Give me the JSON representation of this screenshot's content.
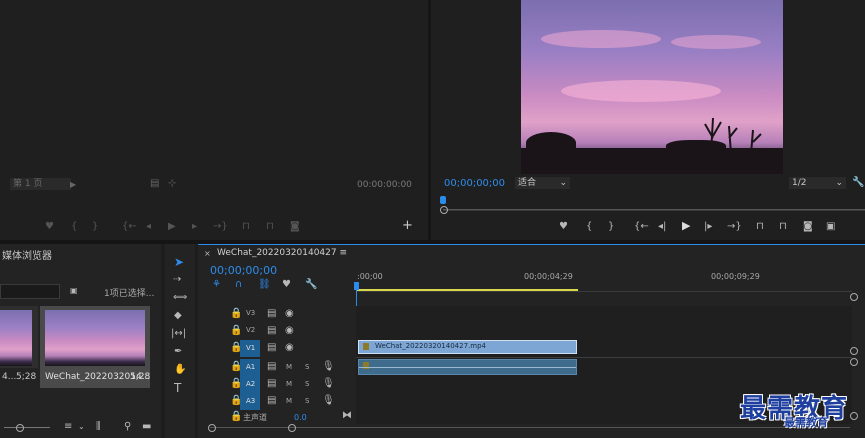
{
  "source_monitor": {
    "page_select": "第 1 页",
    "timecode": "00:00:00:00"
  },
  "program_monitor": {
    "timecode": "00;00;00;00",
    "fit_select": "适合",
    "resolution_select": "1/2"
  },
  "project_panel": {
    "title": "媒体浏览器",
    "selection_status": "1项已选择...",
    "items": [
      {
        "name": "4...",
        "duration": "5;28"
      },
      {
        "name": "WeChat_2022032014...",
        "duration": "5;28"
      }
    ]
  },
  "timeline": {
    "sequence_name": "WeChat_20220320140427",
    "menu_icon": "≡",
    "timecode": "00;00;00;00",
    "ruler_labels": [
      ":00;00",
      "00;00;04;29",
      "00;00;09;29"
    ],
    "video_tracks": [
      {
        "name": "V3"
      },
      {
        "name": "V2"
      },
      {
        "name": "V1",
        "targeted": true
      }
    ],
    "audio_tracks": [
      {
        "name": "A1",
        "m": "M",
        "s": "S"
      },
      {
        "name": "A2",
        "m": "M",
        "s": "S"
      },
      {
        "name": "A3",
        "m": "M",
        "s": "S"
      }
    ],
    "master_track": {
      "name": "主声道",
      "value": "0.0"
    },
    "video_clip": {
      "name": "WeChat_20220320140427.mp4"
    }
  },
  "watermark": {
    "big": "最需教育",
    "small": "最需教育"
  },
  "colors": {
    "accent_blue": "#2d8ceb",
    "clip_video": "#7da6d4",
    "clip_audio": "#3f6b8c",
    "track_target": "#1e5f93"
  },
  "icons": [
    "marker-icon",
    "in-point-icon",
    "out-point-icon",
    "go-to-in-icon",
    "step-back-icon",
    "play-icon",
    "step-forward-icon",
    "go-to-out-icon",
    "insert-icon",
    "overwrite-icon",
    "export-frame-icon",
    "compare-icon",
    "wrench-icon",
    "add-icon",
    "selection-tool-icon",
    "track-select-icon",
    "ripple-edit-icon",
    "razor-icon",
    "slip-icon",
    "pen-icon",
    "hand-icon",
    "type-icon",
    "lock-icon",
    "eye-icon",
    "mic-icon",
    "snap-icon",
    "linked-icon",
    "folder-icon",
    "search-icon"
  ]
}
